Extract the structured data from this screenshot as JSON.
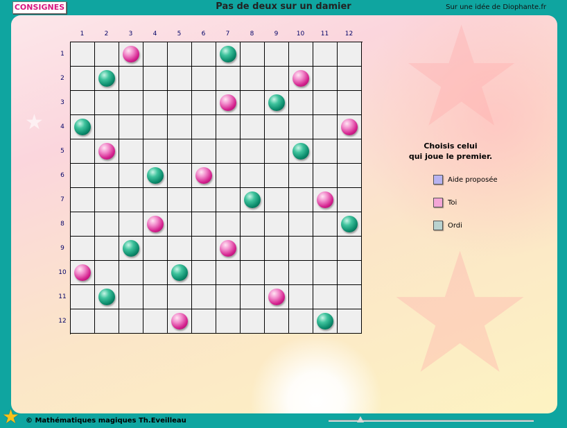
{
  "header": {
    "consignes_label": "CONSIGNES",
    "title": "Pas de deux sur un damier",
    "credit": "Sur une idée de Diophante.fr"
  },
  "board": {
    "size": 12,
    "col_labels": [
      "1",
      "2",
      "3",
      "4",
      "5",
      "6",
      "7",
      "8",
      "9",
      "10",
      "11",
      "12"
    ],
    "row_labels": [
      "1",
      "2",
      "3",
      "4",
      "5",
      "6",
      "7",
      "8",
      "9",
      "10",
      "11",
      "12"
    ],
    "pieces": [
      {
        "row": 1,
        "col": 3,
        "color": "pink"
      },
      {
        "row": 1,
        "col": 7,
        "color": "green"
      },
      {
        "row": 2,
        "col": 2,
        "color": "green"
      },
      {
        "row": 2,
        "col": 10,
        "color": "pink"
      },
      {
        "row": 3,
        "col": 7,
        "color": "pink"
      },
      {
        "row": 3,
        "col": 9,
        "color": "green"
      },
      {
        "row": 4,
        "col": 1,
        "color": "green"
      },
      {
        "row": 4,
        "col": 12,
        "color": "pink"
      },
      {
        "row": 5,
        "col": 2,
        "color": "pink"
      },
      {
        "row": 5,
        "col": 10,
        "color": "green"
      },
      {
        "row": 6,
        "col": 4,
        "color": "green"
      },
      {
        "row": 6,
        "col": 6,
        "color": "pink"
      },
      {
        "row": 7,
        "col": 8,
        "color": "green"
      },
      {
        "row": 7,
        "col": 11,
        "color": "pink"
      },
      {
        "row": 8,
        "col": 4,
        "color": "pink"
      },
      {
        "row": 8,
        "col": 12,
        "color": "green"
      },
      {
        "row": 9,
        "col": 3,
        "color": "green"
      },
      {
        "row": 9,
        "col": 7,
        "color": "pink"
      },
      {
        "row": 10,
        "col": 1,
        "color": "pink"
      },
      {
        "row": 10,
        "col": 5,
        "color": "green"
      },
      {
        "row": 11,
        "col": 2,
        "color": "green"
      },
      {
        "row": 11,
        "col": 9,
        "color": "pink"
      },
      {
        "row": 12,
        "col": 5,
        "color": "pink"
      },
      {
        "row": 12,
        "col": 11,
        "color": "green"
      }
    ]
  },
  "side": {
    "prompt_line1": "Choisis celui",
    "prompt_line2": "qui joue le premier.",
    "options": [
      {
        "label": "Aide proposée",
        "color": "#b7b3f0"
      },
      {
        "label": "Toi",
        "color": "#f3a6d6"
      },
      {
        "label": "Ordi",
        "color": "#b9d2cf"
      }
    ]
  },
  "footer": {
    "copyright": "© Mathématiques magiques Th.Eveilleau"
  },
  "colors": {
    "frame": "#0fa5a0",
    "accent_pink": "#d8157f"
  }
}
